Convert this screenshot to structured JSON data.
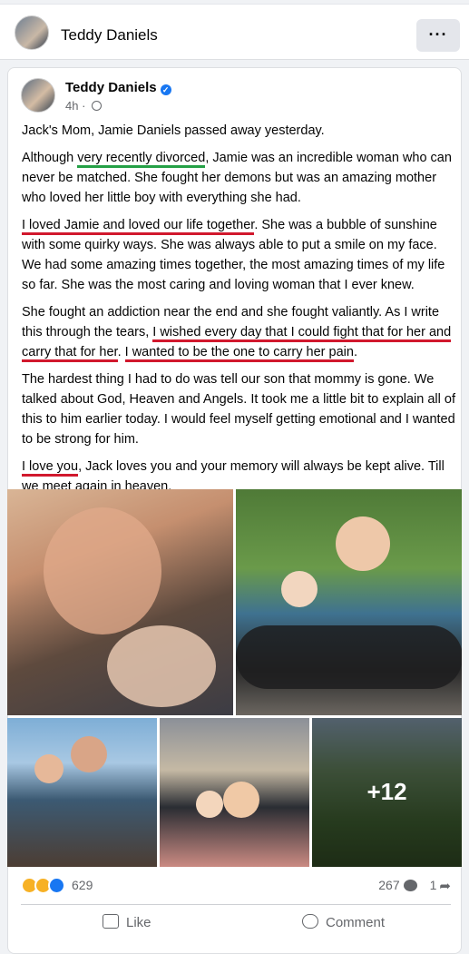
{
  "header": {
    "name": "Teddy Daniels",
    "more_label": "···"
  },
  "post": {
    "author": "Teddy Daniels",
    "verified_mark": "✓",
    "time": "4h",
    "time_separator": " · ",
    "paragraphs": {
      "p1": "Jack's Mom, Jamie Daniels passed away yesterday.",
      "p2a": "Although ",
      "p2b": "very recently divorced",
      "p2c": ", Jamie was an incredible woman who can never be matched.  She fought her demons but was an amazing mother who loved her little boy with everything she had.",
      "p3a": "I loved Jamie and loved our life together",
      "p3b": ". She was a bubble of sunshine with some quirky ways. She was always able to put a smile on my face.  We had some amazing times together, the most amazing times of my life so far.  She was the most caring and loving woman that I ever knew.",
      "p4a": "She fought an addiction near the end and she fought valiantly.  As I write this through the tears, ",
      "p4b": "I wished every day that I could fight that for her and carry that for her",
      "p4c": ".  ",
      "p4d": "I wanted to be the one to carry her pain",
      "p4e": ".",
      "p5": "The hardest thing I had to do was tell our son that mommy is gone.  We talked about God, Heaven and Angels.  It took me a little bit to explain all of this to him earlier today. I would feel myself getting emotional and I wanted to be strong for him.",
      "p6a": "I love you",
      "p6b": ", Jack loves you and your memory will always be kept alive. Till ",
      "p6c": "we meet again in heaven",
      "p6d": "."
    },
    "photos": {
      "more_count": "+12"
    },
    "stats": {
      "reactions": "629",
      "comments": "267",
      "shares": "1"
    },
    "actions": {
      "like": "Like",
      "comment": "Comment"
    },
    "colors": {
      "green_underline": "#25a046",
      "red_underline": "#d1182d",
      "accent": "#1877f2"
    }
  }
}
